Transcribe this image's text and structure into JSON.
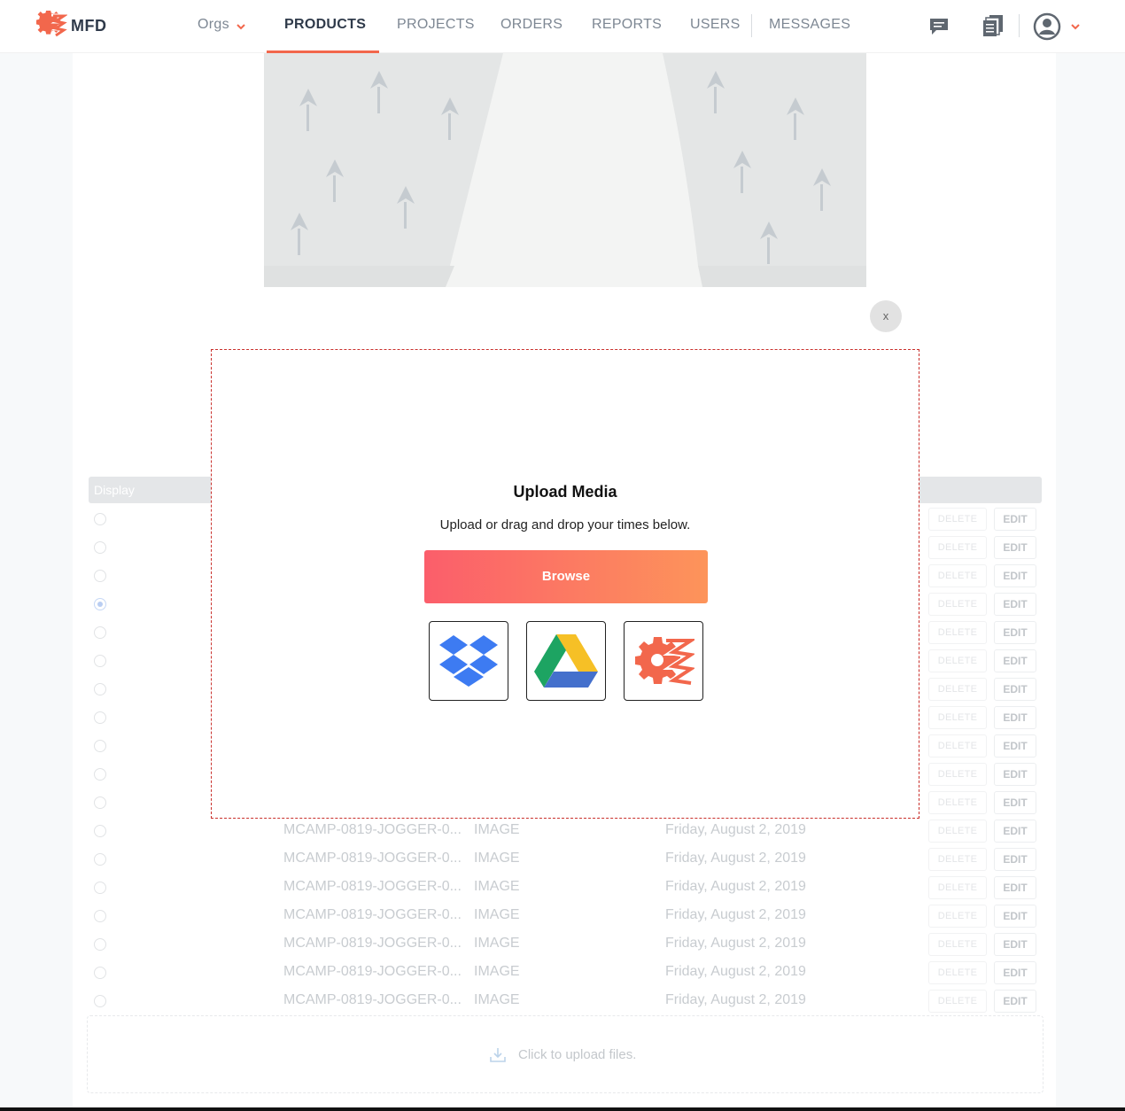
{
  "nav": {
    "logo_text": "MFD",
    "orgs_label": "Orgs",
    "items": [
      "PRODUCTS",
      "PROJECTS",
      "ORDERS",
      "REPORTS",
      "USERS",
      "MESSAGES"
    ],
    "active_item": "PRODUCTS"
  },
  "colors": {
    "accent": "#f2674c",
    "browse_gradient_start": "#fb5e6b",
    "browse_gradient_end": "#fd945a",
    "modal_border": "#c9302c"
  },
  "media_table": {
    "header": "Display",
    "delete_label": "DELETE",
    "edit_label": "EDIT",
    "selected_row_index": 3,
    "visible_rows": [
      {
        "name": "MCAMP-0819-JOGGER-0...",
        "type": "IMAGE",
        "date": "Friday, August 2, 2019"
      },
      {
        "name": "MCAMP-0819-JOGGER-0...",
        "type": "IMAGE",
        "date": "Friday, August 2, 2019"
      },
      {
        "name": "MCAMP-0819-JOGGER-0...",
        "type": "IMAGE",
        "date": "Friday, August 2, 2019"
      },
      {
        "name": "MCAMP-0819-JOGGER-0...",
        "type": "IMAGE",
        "date": "Friday, August 2, 2019"
      },
      {
        "name": "MCAMP-0819-JOGGER-0...",
        "type": "IMAGE",
        "date": "Friday, August 2, 2019"
      },
      {
        "name": "MCAMP-0819-JOGGER-0...",
        "type": "IMAGE",
        "date": "Friday, August 2, 2019"
      },
      {
        "name": "MCAMP-0819-JOGGER-0...",
        "type": "IMAGE",
        "date": "Friday, August 2, 2019"
      }
    ]
  },
  "dropzone": {
    "text": "Click to upload files."
  },
  "close_label": "x",
  "modal": {
    "title": "Upload Media",
    "subtitle": "Upload or drag and drop your times below.",
    "browse_label": "Browse",
    "sources": [
      "dropbox-icon",
      "google-drive-icon",
      "mfd-library-icon"
    ]
  }
}
